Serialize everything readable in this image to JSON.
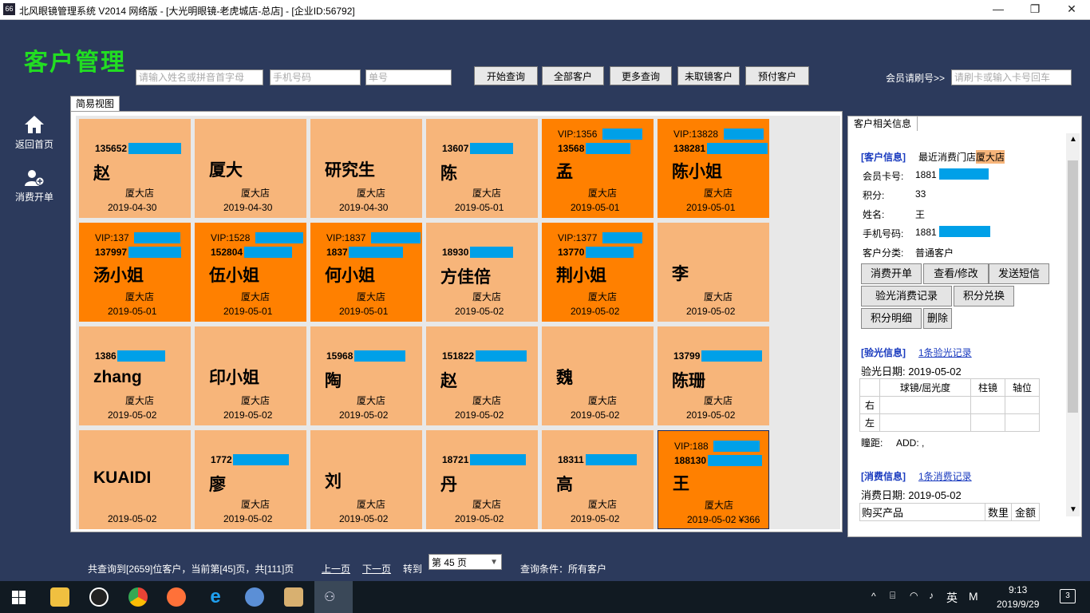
{
  "window": {
    "title": "北风眼镜管理系统 V2014 网络版 - [大光明眼镜-老虎城店-总店] - [企业ID:56792]",
    "icon_text": "66",
    "min": "—",
    "max": "❐",
    "close": "✕"
  },
  "app_title": "客户管理",
  "search": {
    "name_placeholder": "请输入姓名或拼音首字母",
    "phone_placeholder": "手机号码",
    "order_placeholder": "单号",
    "buttons": [
      "开始查询",
      "全部客户",
      "更多查询",
      "未取镜客户",
      "预付客户"
    ],
    "member_label": "会员请刷号>>",
    "card_placeholder": "请刷卡或输入卡号回车"
  },
  "sidebar": [
    {
      "label": "返回首页",
      "icon": "home-icon"
    },
    {
      "label": "消费开单",
      "icon": "user-add-icon"
    }
  ],
  "grid_tab": "简易视图",
  "customers": [
    {
      "vip": "",
      "phone": "135652",
      "name": "赵",
      "store": "厦大店",
      "date": "2019-04-30",
      "style": "light"
    },
    {
      "vip": "",
      "phone": "",
      "name": "厦大",
      "store": "厦大店",
      "date": "2019-04-30",
      "style": "light"
    },
    {
      "vip": "",
      "phone": "",
      "name": "研究生",
      "store": "厦大店",
      "date": "2019-04-30",
      "style": "light"
    },
    {
      "vip": "",
      "phone": "13607",
      "name": "陈",
      "store": "厦大店",
      "date": "2019-05-01",
      "style": "light"
    },
    {
      "vip": "VIP:1356",
      "phone": "13568",
      "name": "孟",
      "store": "厦大店",
      "date": "2019-05-01",
      "style": "dark"
    },
    {
      "vip": "VIP:13828",
      "phone": "138281",
      "name": "陈小姐",
      "store": "厦大店",
      "date": "2019-05-01",
      "style": "dark"
    },
    {
      "vip": "VIP:137",
      "phone": "137997",
      "name": "汤小姐",
      "store": "厦大店",
      "date": "2019-05-01",
      "style": "dark"
    },
    {
      "vip": "VIP:1528",
      "phone": "152804",
      "name": "伍小姐",
      "store": "厦大店",
      "date": "2019-05-01",
      "style": "dark"
    },
    {
      "vip": "VIP:1837",
      "phone": "1837",
      "name": "何小姐",
      "store": "厦大店",
      "date": "2019-05-01",
      "style": "dark"
    },
    {
      "vip": "",
      "phone": "18930",
      "name": "方佳倍",
      "store": "厦大店",
      "date": "2019-05-02",
      "style": "light"
    },
    {
      "vip": "VIP:1377",
      "phone": "13770",
      "name": "荆小姐",
      "store": "厦大店",
      "date": "2019-05-02",
      "style": "dark"
    },
    {
      "vip": "",
      "phone": "",
      "name": "李",
      "store": "厦大店",
      "date": "2019-05-02",
      "style": "light"
    },
    {
      "vip": "",
      "phone": "1386",
      "name": "zhang",
      "store": "厦大店",
      "date": "2019-05-02",
      "style": "light"
    },
    {
      "vip": "",
      "phone": "",
      "name": "印小姐",
      "store": "厦大店",
      "date": "2019-05-02",
      "style": "light"
    },
    {
      "vip": "",
      "phone": "15968",
      "name": "陶",
      "store": "厦大店",
      "date": "2019-05-02",
      "style": "light"
    },
    {
      "vip": "",
      "phone": "151822",
      "name": "赵",
      "store": "厦大店",
      "date": "2019-05-02",
      "style": "light"
    },
    {
      "vip": "",
      "phone": "",
      "name": "魏",
      "store": "厦大店",
      "date": "2019-05-02",
      "style": "light"
    },
    {
      "vip": "",
      "phone": "13799",
      "name": "陈珊",
      "store": "厦大店",
      "date": "2019-05-02",
      "style": "light"
    },
    {
      "vip": "",
      "phone": "",
      "name": "KUAIDI",
      "store": "",
      "date": "2019-05-02",
      "style": "light"
    },
    {
      "vip": "",
      "phone": "1772",
      "name": "廖",
      "store": "厦大店",
      "date": "2019-05-02",
      "style": "light"
    },
    {
      "vip": "",
      "phone": "",
      "name": "刘",
      "store": "厦大店",
      "date": "2019-05-02",
      "style": "light"
    },
    {
      "vip": "",
      "phone": "18721",
      "name": "丹",
      "store": "厦大店",
      "date": "2019-05-02",
      "style": "light"
    },
    {
      "vip": "",
      "phone": "18311",
      "name": "高",
      "store": "厦大店",
      "date": "2019-05-02",
      "style": "light"
    },
    {
      "vip": "VIP:188",
      "phone": "188130",
      "name": "王",
      "store": "厦大店",
      "date": "2019-05-02  ¥366",
      "style": "dark"
    }
  ],
  "detail": {
    "tab": "客户相关信息",
    "customer_header": "[客户信息]",
    "last_store_label": "最近消费门店",
    "last_store": "厦大店",
    "card_label": "会员卡号:",
    "card_value": "1881",
    "points_label": "积分:",
    "points_value": "33",
    "name_label": "姓名:",
    "name_value": "王",
    "phone_label": "手机号码:",
    "phone_value": "1881",
    "category_label": "客户分类:",
    "category_value": "普通客户",
    "buttons_row1": [
      "消费开单",
      "查看/修改",
      "发送短信"
    ],
    "buttons_row2": [
      "验光消费记录",
      "积分兑换"
    ],
    "buttons_row3": [
      "积分明细",
      "删除"
    ],
    "optometry_header": "[验光信息]",
    "optometry_link": "1条验光记录",
    "optometry_date": "验光日期: 2019-05-02",
    "optometry_cols": [
      "球镜/屈光度",
      "柱镜",
      "轴位"
    ],
    "optometry_rows": [
      "右",
      "左"
    ],
    "pupil": "瞳距:     ADD: ,",
    "consume_header": "[消费信息]",
    "consume_link": "1条消费记录",
    "consume_date": "消费日期: 2019-05-02",
    "consume_cols": [
      "购买产品",
      "数里",
      "金额"
    ]
  },
  "pager": {
    "summary": "共查询到[2659]位客户，当前第[45]页，共[111]页",
    "prev": "上一页",
    "next": "下一页",
    "goto": "转到",
    "page_select": "第 45 页",
    "condition": "查询条件：所有客户"
  },
  "taskbar": {
    "ime": "英",
    "ime2": "M",
    "time": "9:13",
    "date": "2019/9/29",
    "notif": "3"
  }
}
